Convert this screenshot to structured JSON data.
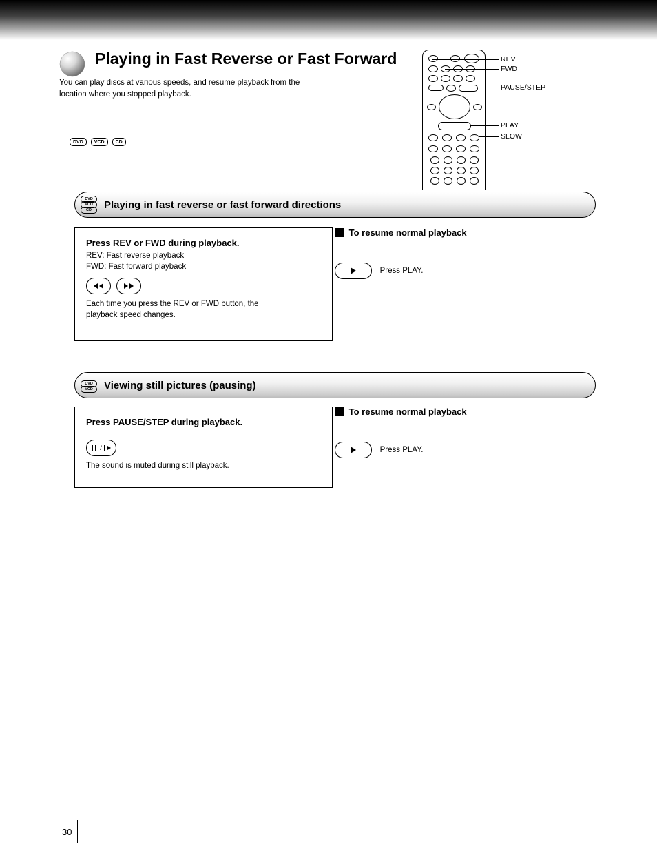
{
  "header": {
    "title": "Playing in Fast Reverse or Fast Forward",
    "subtitle_lines": [
      "You can play discs at various speeds, and resume playback from the",
      "location where you stopped playback."
    ]
  },
  "badges": [
    {
      "text": "DVD",
      "sub": ""
    },
    {
      "text": "VCD",
      "sub": ""
    },
    {
      "text": "CD",
      "sub": ""
    }
  ],
  "remote_labels": {
    "l1": "REV",
    "l2": "FWD",
    "l3": "PAUSE/STEP",
    "l4": "PLAY",
    "l5": "SLOW"
  },
  "section1": {
    "title": "Playing in fast reverse or fast forward directions",
    "icon_badges": [
      "DVD",
      "VCD",
      "CD"
    ],
    "step_title": "Press REV or FWD during playback.",
    "step_body_lines": [
      "REV: Fast reverse playback",
      "FWD: Fast forward playback",
      "Each time you press the REV or FWD button, the",
      "playback speed changes."
    ],
    "right_title": "To resume normal playback",
    "right_label": "Press PLAY."
  },
  "section2": {
    "title": "Viewing still pictures (pausing)",
    "icon_badges": [
      "DVD",
      "VCD"
    ],
    "step_title": "Press PAUSE/STEP during playback.",
    "step_body": "The sound is muted during still playback.",
    "right_title": "To resume normal playback",
    "right_label": "Press PLAY."
  },
  "page_number": "30"
}
